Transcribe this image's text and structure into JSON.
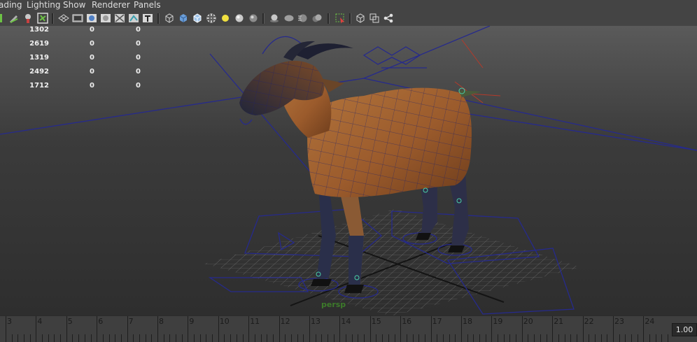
{
  "menu": [
    "ading",
    "Lighting",
    "Show",
    "Renderer",
    "Panels"
  ],
  "toolbar_icons": [
    "snap-icon",
    "pencil-icon",
    "bookmark-icon",
    "camera-attr-icon",
    "grid-toggle-icon",
    "film-gate-icon",
    "resolution-gate-icon",
    "gate-mask-icon",
    "safe-action-icon",
    "xray-joints-icon",
    "field-chart-icon",
    "text-icon",
    "wireframe-icon",
    "smooth-shade-icon",
    "wireframe-on-shaded-icon",
    "texture-icon",
    "default-light-icon",
    "all-lights-icon",
    "shadows-icon",
    "isolate-select-icon",
    "ambient-occlusion-icon",
    "motion-blur-icon",
    "multisample-icon",
    "select-camera-icon",
    "cube-icon",
    "frame-all-icon",
    "share-icon"
  ],
  "hud": {
    "rows": [
      [
        "1302",
        "0",
        "0"
      ],
      [
        "2619",
        "0",
        "0"
      ],
      [
        "1319",
        "0",
        "0"
      ],
      [
        "2492",
        "0",
        "0"
      ],
      [
        "1712",
        "0",
        "0"
      ]
    ]
  },
  "viewport": {
    "camera": "persp"
  },
  "timeline": {
    "ticks": [
      "3",
      "4",
      "5",
      "6",
      "7",
      "8",
      "9",
      "10",
      "11",
      "12",
      "13",
      "14",
      "15",
      "16",
      "17",
      "18",
      "19",
      "20",
      "21",
      "22",
      "23",
      "24"
    ],
    "current_frame": "1.00"
  }
}
